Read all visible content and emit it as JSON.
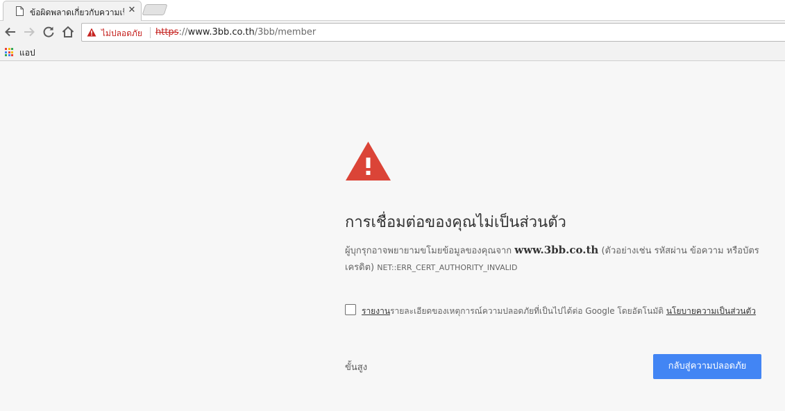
{
  "tab": {
    "title": "ข้อผิดพลาดเกี่ยวกับความเป็นส่วนตัว",
    "close_glyph": "✕",
    "favicon": "page-icon"
  },
  "toolbar": {
    "back_icon": "arrow-back-icon",
    "forward_icon": "arrow-forward-icon",
    "reload_icon": "reload-icon",
    "home_icon": "home-icon"
  },
  "omnibox": {
    "security_label": "ไม่ปลอดภัย",
    "url_scheme": "https",
    "url_sep": "://",
    "url_host": "www.3bb.co.th",
    "url_path": "/3bb/member"
  },
  "bookmarks": {
    "apps_label": "แอป"
  },
  "interstitial": {
    "heading": "การเชื่อมต่อของคุณไม่เป็นส่วนตัว",
    "explanation_before": "ผู้บุกรุกอาจพยายามขโมยข้อมูลของคุณจาก ",
    "explanation_host": "www.3bb.co.th",
    "explanation_after": " (ตัวอย่างเช่น รหัสผ่าน ข้อความ หรือบัตรเครดิต) ",
    "error_code": "NET::ERR_CERT_AUTHORITY_INVALID",
    "report_link": "รายงาน",
    "report_text": "รายละเอียดของเหตุการณ์ความปลอดภัยที่เป็นไปได้ต่อ Google โดยอัตโนมัติ ",
    "privacy_link": "นโยบายความเป็นส่วนตัว",
    "advanced_label": "ขั้นสูง",
    "back_to_safety_label": "กลับสู่ความปลอดภัย"
  },
  "colors": {
    "warning_red": "#db4437",
    "insecure_red": "#c5221f",
    "primary_blue": "#4285f4"
  }
}
